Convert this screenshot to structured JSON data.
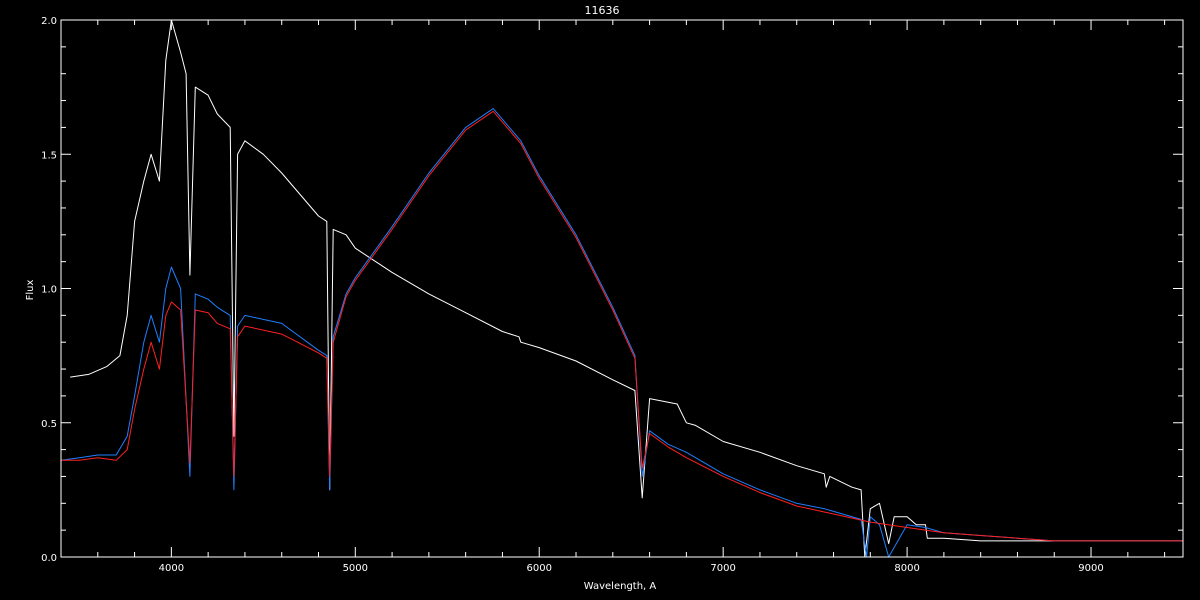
{
  "chart_data": {
    "type": "line",
    "title": "11636",
    "xlabel": "Wavelength, A",
    "ylabel": "Flux",
    "xlim": [
      3400,
      9500
    ],
    "ylim": [
      0.0,
      2.0
    ],
    "xticks": [
      4000,
      5000,
      6000,
      7000,
      8000,
      9000
    ],
    "xtick_labels": [
      "4000",
      "5000",
      "6000",
      "7000",
      "8000",
      "9000"
    ],
    "yticks": [
      0.0,
      0.5,
      1.0,
      1.5,
      2.0
    ],
    "ytick_labels": [
      "0.0",
      "0.5",
      "1.0",
      "1.5",
      "2.0"
    ],
    "grid": false,
    "background": "#000000",
    "axis_color": "#ffffff",
    "series": [
      {
        "color": "#ffffff",
        "x": [
          3450,
          3550,
          3650,
          3720,
          3760,
          3800,
          3850,
          3890,
          3935,
          3970,
          4000,
          4050,
          4080,
          4101,
          4130,
          4200,
          4250,
          4320,
          4340,
          4360,
          4400,
          4500,
          4600,
          4700,
          4800,
          4845,
          4861,
          4880,
          4950,
          5000,
          5200,
          5400,
          5600,
          5800,
          5890,
          5900,
          6000,
          6200,
          6400,
          6520,
          6560,
          6600,
          6750,
          6800,
          6850,
          7000,
          7200,
          7400,
          7550,
          7560,
          7580,
          7700,
          7750,
          7770,
          7800,
          7850,
          7900,
          7930,
          8000,
          8050,
          8100,
          8110,
          8200,
          8400,
          8600,
          8800,
          9000,
          9200,
          9400,
          9500
        ],
        "y": [
          0.67,
          0.68,
          0.71,
          0.75,
          0.9,
          1.25,
          1.4,
          1.5,
          1.4,
          1.85,
          2.0,
          1.88,
          1.8,
          1.05,
          1.75,
          1.72,
          1.65,
          1.6,
          0.45,
          1.5,
          1.55,
          1.5,
          1.43,
          1.35,
          1.27,
          1.25,
          0.25,
          1.22,
          1.2,
          1.15,
          1.06,
          0.98,
          0.91,
          0.84,
          0.82,
          0.8,
          0.78,
          0.73,
          0.66,
          0.62,
          0.22,
          0.59,
          0.57,
          0.5,
          0.49,
          0.43,
          0.39,
          0.34,
          0.31,
          0.26,
          0.3,
          0.26,
          0.25,
          0.0,
          0.18,
          0.2,
          0.05,
          0.15,
          0.15,
          0.12,
          0.12,
          0.07,
          0.07,
          0.06,
          0.06,
          0.06,
          0.06,
          0.06,
          0.06,
          0.06
        ]
      },
      {
        "color": "#1e7fff",
        "x": [
          3400,
          3500,
          3600,
          3700,
          3760,
          3800,
          3850,
          3890,
          3935,
          3970,
          4000,
          4050,
          4101,
          4130,
          4200,
          4250,
          4320,
          4340,
          4360,
          4400,
          4600,
          4800,
          4845,
          4861,
          4880,
          4950,
          5000,
          5200,
          5400,
          5600,
          5750,
          5900,
          6000,
          6200,
          6400,
          6520,
          6560,
          6600,
          6700,
          6800,
          7000,
          7200,
          7400,
          7550,
          7600,
          7750,
          7780,
          7800,
          7850,
          7900,
          8000,
          8100,
          8200,
          8400,
          8600,
          8800,
          9000,
          9200,
          9400,
          9500
        ],
        "y": [
          0.36,
          0.37,
          0.38,
          0.38,
          0.45,
          0.6,
          0.8,
          0.9,
          0.8,
          1.0,
          1.08,
          1.0,
          0.3,
          0.98,
          0.96,
          0.93,
          0.9,
          0.25,
          0.86,
          0.9,
          0.87,
          0.77,
          0.75,
          0.25,
          0.82,
          0.98,
          1.04,
          1.23,
          1.43,
          1.6,
          1.67,
          1.55,
          1.42,
          1.2,
          0.93,
          0.75,
          0.3,
          0.47,
          0.42,
          0.39,
          0.31,
          0.25,
          0.2,
          0.18,
          0.17,
          0.14,
          0.0,
          0.15,
          0.12,
          0.0,
          0.12,
          0.11,
          0.09,
          0.08,
          0.07,
          0.06,
          0.06,
          0.06,
          0.06,
          0.06
        ]
      },
      {
        "color": "#ff2020",
        "x": [
          3400,
          3500,
          3600,
          3700,
          3760,
          3800,
          3850,
          3890,
          3935,
          3970,
          4000,
          4050,
          4101,
          4130,
          4200,
          4250,
          4320,
          4340,
          4360,
          4400,
          4600,
          4800,
          4845,
          4861,
          4880,
          4950,
          5000,
          5200,
          5400,
          5600,
          5750,
          5900,
          6000,
          6200,
          6400,
          6520,
          6560,
          6600,
          6700,
          6800,
          7000,
          7200,
          7400,
          7600,
          7800,
          8000,
          8200,
          8400,
          8600,
          8800,
          9000,
          9200,
          9400,
          9500
        ],
        "y": [
          0.36,
          0.36,
          0.37,
          0.36,
          0.4,
          0.55,
          0.7,
          0.8,
          0.7,
          0.9,
          0.95,
          0.92,
          0.35,
          0.92,
          0.91,
          0.87,
          0.85,
          0.3,
          0.82,
          0.86,
          0.83,
          0.76,
          0.74,
          0.3,
          0.8,
          0.97,
          1.03,
          1.22,
          1.42,
          1.59,
          1.66,
          1.54,
          1.41,
          1.19,
          0.92,
          0.74,
          0.33,
          0.46,
          0.41,
          0.37,
          0.3,
          0.24,
          0.19,
          0.16,
          0.13,
          0.11,
          0.09,
          0.08,
          0.07,
          0.06,
          0.06,
          0.06,
          0.06,
          0.06
        ]
      }
    ]
  }
}
